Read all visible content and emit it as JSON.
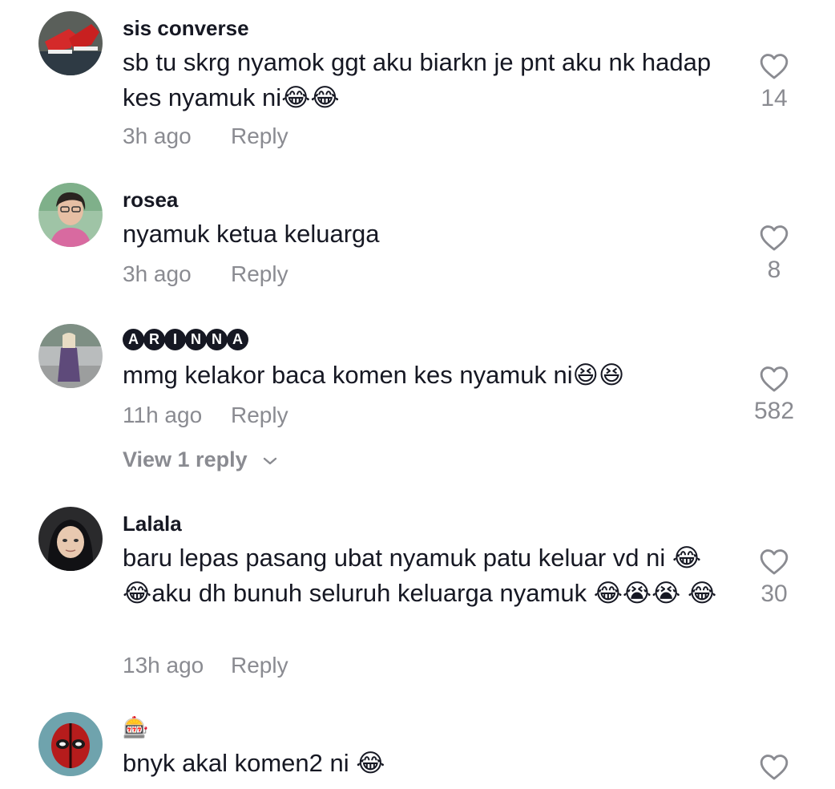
{
  "comments": [
    {
      "username": "sis converse",
      "text": "sb tu skrg nyamok ggt aku biarkn je pnt aku nk hadap kes nyamuk ni😂😂",
      "time": "3h ago",
      "reply": "Reply",
      "likes": "14",
      "avatar": "red-sneakers-avatar"
    },
    {
      "username": "rosea",
      "text": "nyamuk ketua keluarga",
      "time": "3h ago",
      "reply": "Reply",
      "likes": "8",
      "avatar": "woman-glasses-avatar"
    },
    {
      "username": "ARINNA",
      "username_letters": [
        "A",
        "R",
        "I",
        "N",
        "N",
        "A"
      ],
      "text": "mmg kelakor baca komen kes nyamuk ni😆😆",
      "time": "11h ago",
      "reply": "Reply",
      "likes": "582",
      "view_replies": "View 1 reply",
      "avatar": "woman-hijab-street-avatar"
    },
    {
      "username": "Lalala",
      "text": "baru lepas pasang ubat nyamuk patu keluar vd ni 😂😂aku dh bunuh seluruh keluarga nyamuk 😂😭😭 😂",
      "time": "13h ago",
      "reply": "Reply",
      "likes": "30",
      "avatar": "girl-hijab-avatar"
    },
    {
      "username": "🎰",
      "text": "bnyk akal komen2 ni 😂",
      "avatar": "deadpool-avatar"
    }
  ],
  "colors": {
    "text_primary": "#161823",
    "text_secondary": "#8a8b91",
    "background": "#ffffff"
  },
  "icons": {
    "like": "heart-outline-icon",
    "expand": "chevron-down-icon"
  }
}
